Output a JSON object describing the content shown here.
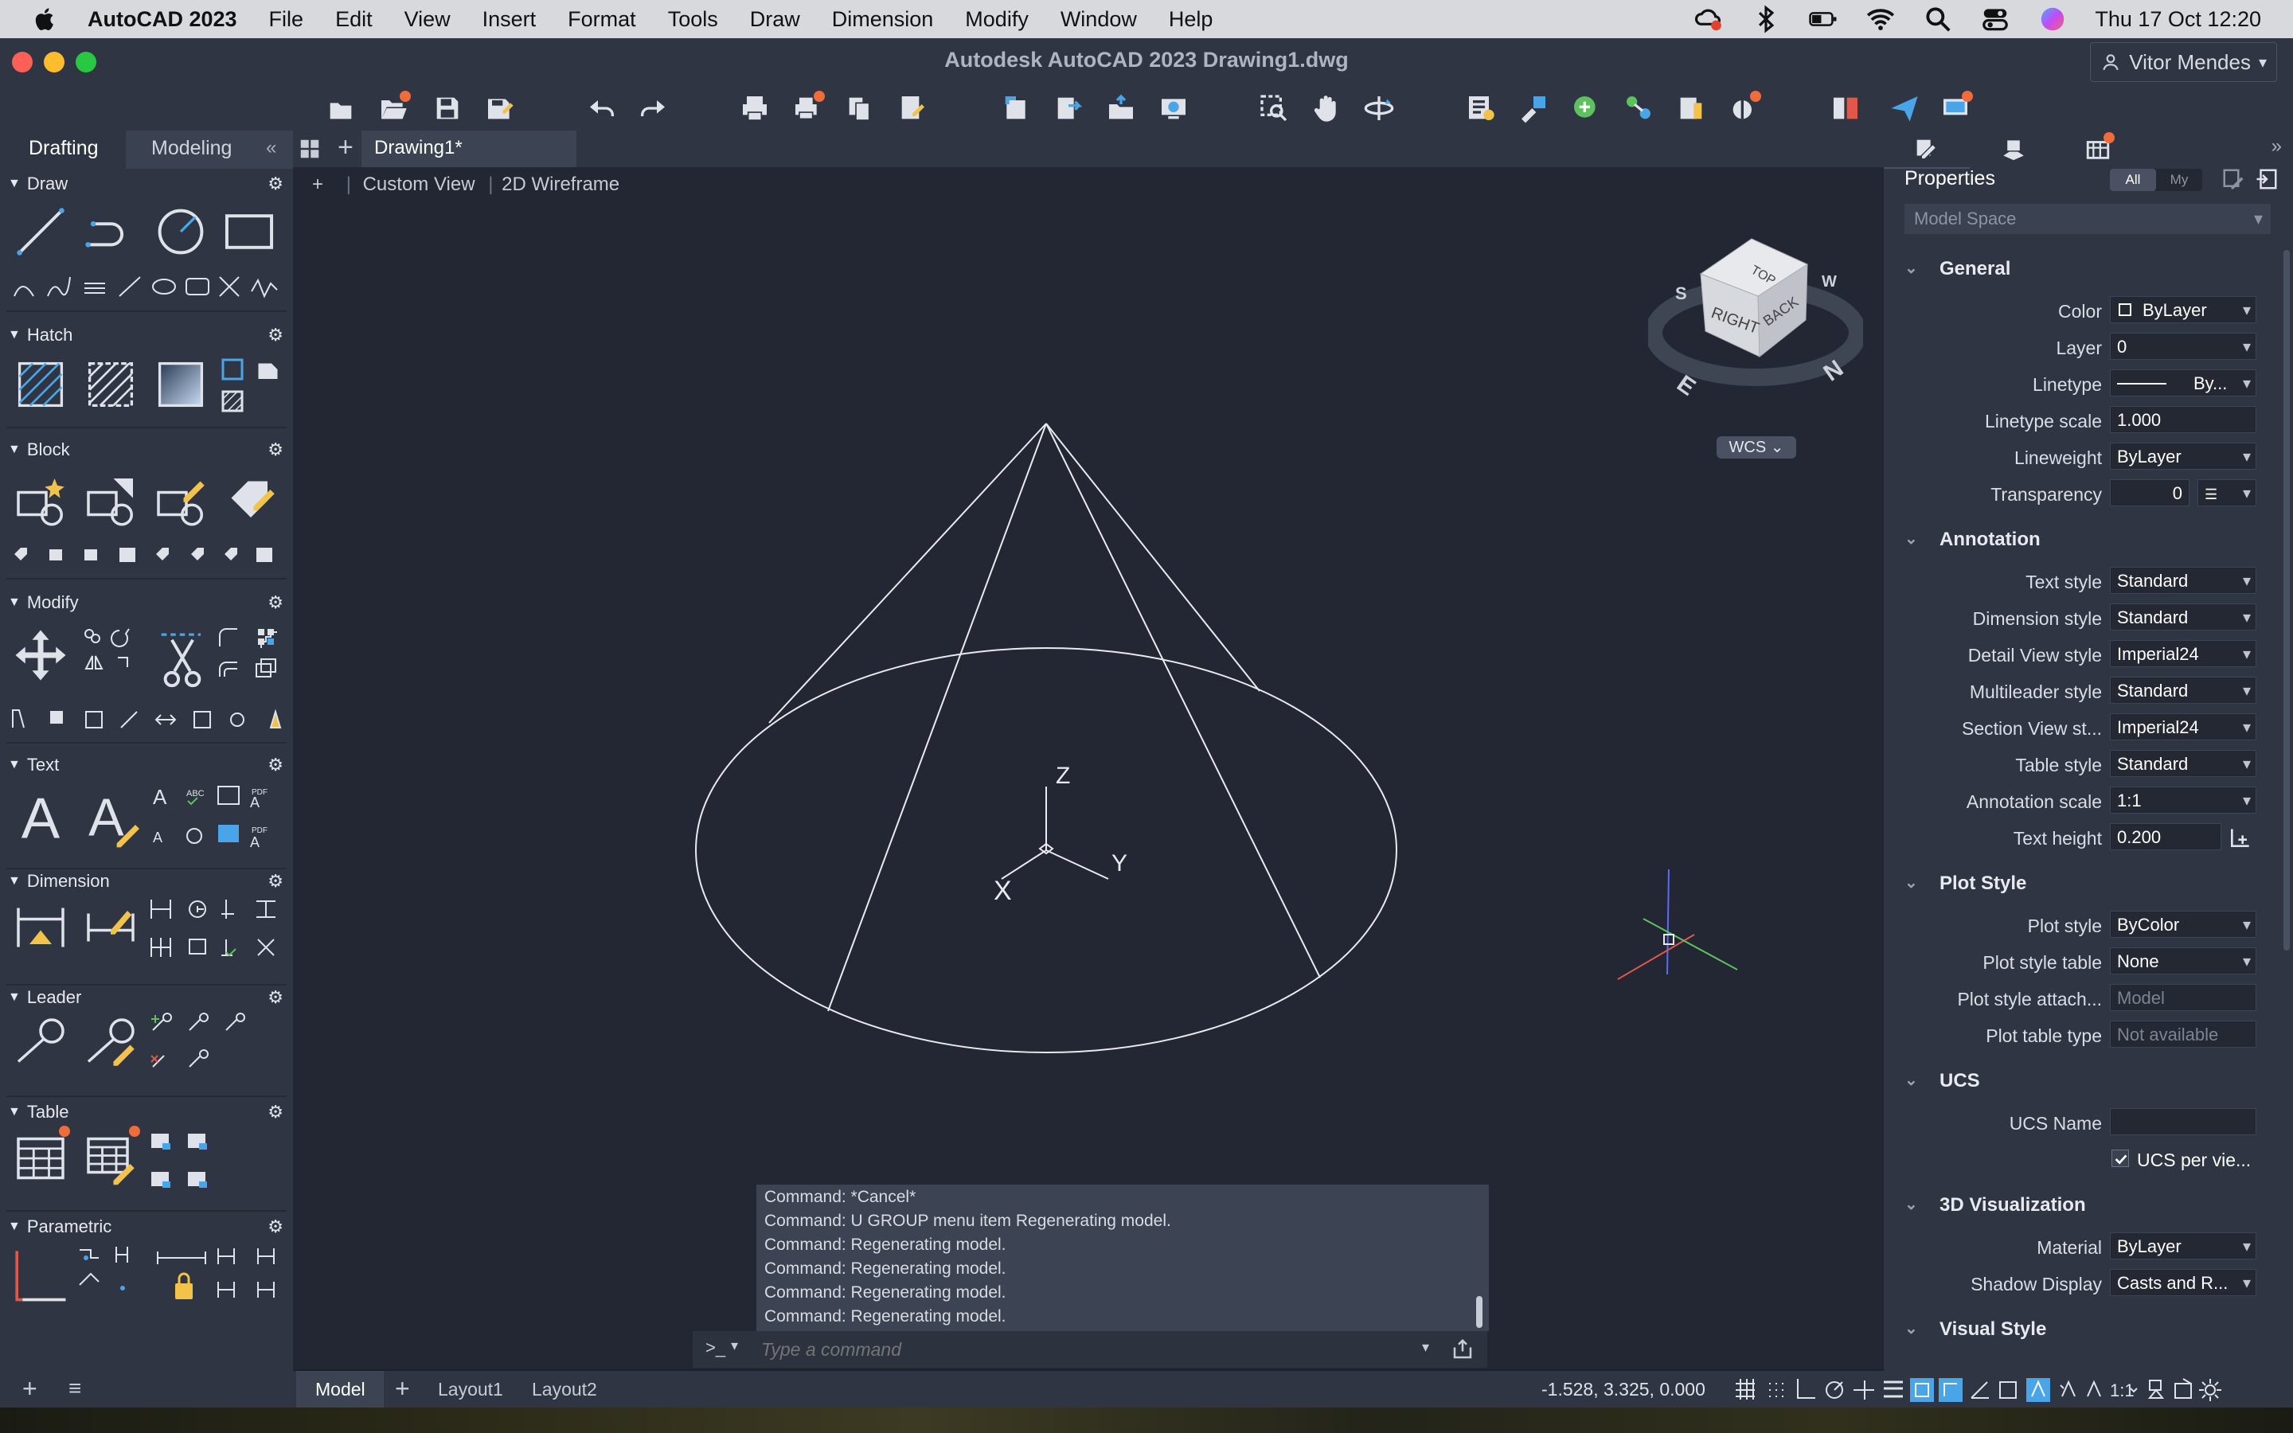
{
  "menubar": {
    "app_name": "AutoCAD 2023",
    "items": [
      "File",
      "Edit",
      "View",
      "Insert",
      "Format",
      "Tools",
      "Draw",
      "Dimension",
      "Modify",
      "Window",
      "Help"
    ],
    "clock": "Thu 17 Oct  12:20"
  },
  "titlebar": {
    "title": "Autodesk AutoCAD 2023    Drawing1.dwg",
    "user": "Vitor Mendes"
  },
  "left_panel": {
    "tabs": [
      "Drafting",
      "Modeling"
    ],
    "sections": [
      "Draw",
      "Hatch",
      "Block",
      "Modify",
      "Text",
      "Dimension",
      "Leader",
      "Table",
      "Parametric"
    ]
  },
  "drawing": {
    "tab_label": "Drawing1*",
    "view_label": "Custom View",
    "visual_style": "2D Wireframe",
    "wcs_label": "WCS",
    "viewcube": {
      "top": "TOP",
      "right": "RIGHT",
      "back": "BACK",
      "south": "S",
      "east": "E",
      "north": "N",
      "west": "W"
    },
    "ucs_axes": {
      "x": "X",
      "y": "Y",
      "z": "Z"
    }
  },
  "properties": {
    "title": "Properties",
    "filter_all": "All",
    "filter_my": "My",
    "scope": "Model Space",
    "sections": {
      "general": "General",
      "annotation": "Annotation",
      "plot_style": "Plot Style",
      "ucs": "UCS",
      "viz3d": "3D Visualization",
      "visual_style": "Visual Style"
    },
    "general": [
      {
        "label": "Color",
        "value": "ByLayer"
      },
      {
        "label": "Layer",
        "value": "0"
      },
      {
        "label": "Linetype",
        "value": "By..."
      },
      {
        "label": "Linetype scale",
        "value": "1.000"
      },
      {
        "label": "Lineweight",
        "value": "ByLayer"
      },
      {
        "label": "Transparency",
        "value": "0"
      }
    ],
    "annotation": [
      {
        "label": "Text style",
        "value": "Standard"
      },
      {
        "label": "Dimension style",
        "value": "Standard"
      },
      {
        "label": "Detail View style",
        "value": "Imperial24"
      },
      {
        "label": "Multileader style",
        "value": "Standard"
      },
      {
        "label": "Section View st...",
        "value": "Imperial24"
      },
      {
        "label": "Table style",
        "value": "Standard"
      },
      {
        "label": "Annotation scale",
        "value": "1:1"
      },
      {
        "label": "Text height",
        "value": "0.200"
      }
    ],
    "plot_style": [
      {
        "label": "Plot style",
        "value": "ByColor"
      },
      {
        "label": "Plot style table",
        "value": "None"
      },
      {
        "label": "Plot style attach...",
        "value": "Model"
      },
      {
        "label": "Plot table type",
        "value": "Not available"
      }
    ],
    "ucs": {
      "name_label": "UCS Name",
      "name_value": "",
      "per_view_label": "UCS per vie...",
      "per_view_checked": true
    },
    "viz3d": [
      {
        "label": "Material",
        "value": "ByLayer"
      },
      {
        "label": "Shadow Display",
        "value": "Casts and R..."
      }
    ]
  },
  "command": {
    "history": [
      "Command: *Cancel*",
      "Command: U GROUP menu item Regenerating model.",
      "Command:  Regenerating model.",
      "Command:  Regenerating model.",
      "Command:  Regenerating model.",
      "Command:  Regenerating model."
    ],
    "prompt_symbol": ">_",
    "placeholder": "Type a command"
  },
  "statusbar": {
    "layout_tabs": [
      "Model",
      "Layout1",
      "Layout2"
    ],
    "coordinates": "-1.528, 3.325, 0.000",
    "scale": "1:1"
  },
  "colors": {
    "accent_orange": "#f26b3a",
    "panel": "#2f3542",
    "canvas": "#222733",
    "axis_red": "#e0574c",
    "axis_green": "#5cc25c",
    "axis_blue": "#5a6bff"
  }
}
